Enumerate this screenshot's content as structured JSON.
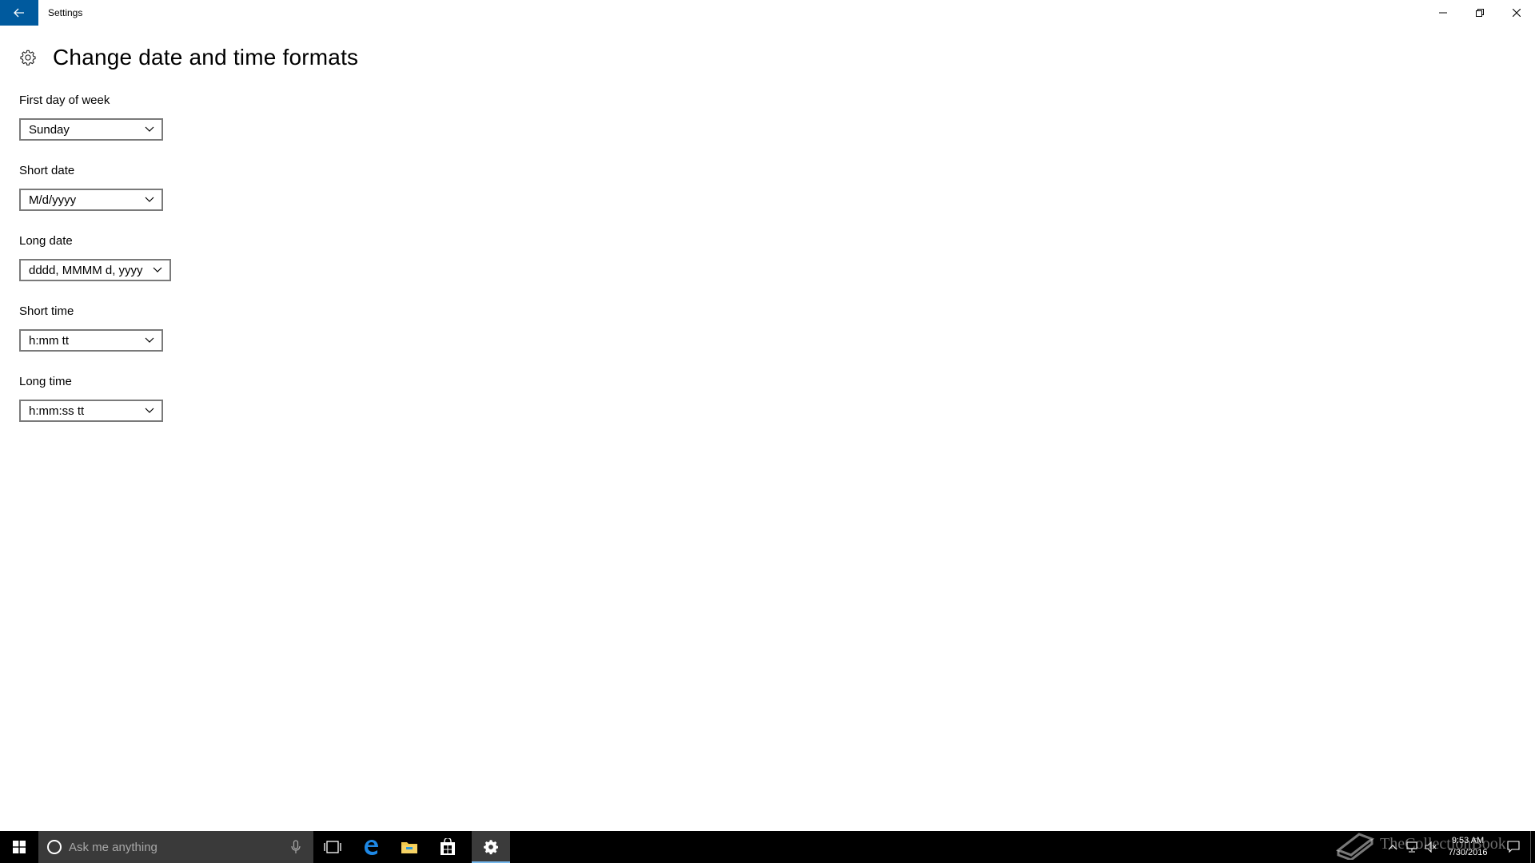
{
  "window": {
    "title": "Settings"
  },
  "header": {
    "title": "Change date and time formats"
  },
  "settings": [
    {
      "label": "First day of week",
      "value": "Sunday"
    },
    {
      "label": "Short date",
      "value": "M/d/yyyy"
    },
    {
      "label": "Long date",
      "value": "dddd, MMMM d, yyyy"
    },
    {
      "label": "Short time",
      "value": "h:mm tt"
    },
    {
      "label": "Long time",
      "value": "h:mm:ss tt"
    }
  ],
  "taskbar": {
    "search_placeholder": "Ask me anything",
    "clock_time": "9:53 AM",
    "clock_date": "7/30/2016",
    "pinned_icons": [
      "task-view-icon",
      "edge-icon",
      "file-explorer-icon",
      "store-icon",
      "settings-icon"
    ],
    "tray_icons": [
      "chevron-up-icon",
      "network-icon",
      "volume-muted-icon"
    ]
  },
  "watermark": {
    "text": "TheCollectionBook"
  },
  "colors": {
    "accent": "#005a9e",
    "taskbar": "#000000",
    "search_box": "#3a3a3a",
    "active_indicator": "#76b9ed",
    "combo_border": "#7a7a7a"
  }
}
